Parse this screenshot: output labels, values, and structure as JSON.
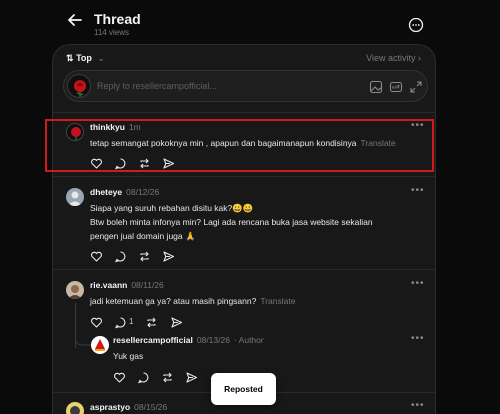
{
  "header": {
    "title": "Thread",
    "views": "114 views"
  },
  "panel": {
    "sort_label": "Top",
    "view_activity": "View activity",
    "reply_placeholder": "Reply to resellercampofficial..."
  },
  "posts": [
    {
      "username": "thinkkyu",
      "time": "1m",
      "text": "tetap semangat pokoknya min , apapun dan bagaimanapun kondisinya",
      "translate": "Translate"
    },
    {
      "username": "dheteye",
      "time": "08/12/26",
      "lines": [
        "Siapa yang suruh rebahan disitu kak?😀😀",
        "Btw boleh minta infonya min? Lagi ada rencana buka jasa website sekalian",
        "pengen jual domain juga 🙏"
      ]
    },
    {
      "username": "rie.vaann",
      "time": "08/11/26",
      "text": "jadi ketemuan ga ya? atau masih pingsann?",
      "translate": "Translate",
      "reply_count": "1"
    },
    {
      "username": "resellercampofficial",
      "time": "08/13/26",
      "badge": "· Author",
      "text": "Yuk gas"
    },
    {
      "username": "asprastyo",
      "time": "08/15/26"
    }
  ],
  "toast": {
    "label": "Reposted"
  },
  "colors": {
    "highlight": "#d11a1a",
    "background": "#0a0a0a",
    "panel": "#181818"
  }
}
